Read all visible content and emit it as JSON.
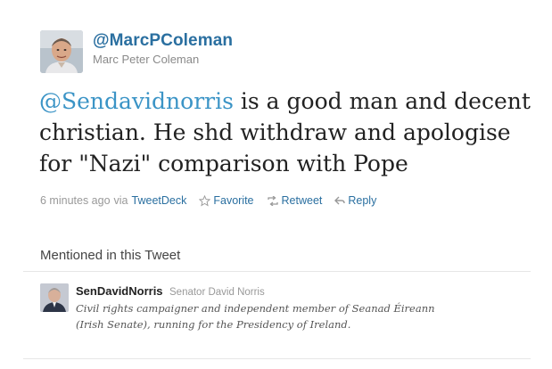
{
  "author": {
    "handle": "@MarcPColeman",
    "name": "Marc Peter Coleman",
    "avatar": "user-photo"
  },
  "tweet": {
    "mention": "@Sendavidnorris",
    "text": " is a good man and decent christian. He shd withdraw and apologise for \"Nazi\" comparison with Pope"
  },
  "meta": {
    "time": "6 minutes ago",
    "via": "via",
    "source": "TweetDeck",
    "actions": {
      "favorite": "Favorite",
      "retweet": "Retweet",
      "reply": "Reply"
    },
    "icons": [
      "star-icon",
      "retweet-icon",
      "reply-icon"
    ]
  },
  "mentioned": {
    "title": "Mentioned in this Tweet",
    "user": {
      "handle": "SenDavidNorris",
      "name": "Senator David Norris",
      "bio": "Civil rights campaigner and independent member of Seanad Éireann (Irish Senate), running for the Presidency of Ireland."
    }
  },
  "colors": {
    "link": "#2a6fa0",
    "mention": "#3b94c6",
    "muted": "#999999"
  }
}
